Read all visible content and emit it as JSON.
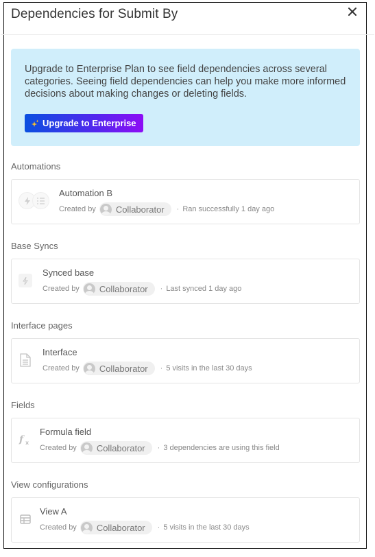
{
  "dialog": {
    "title": "Dependencies for Submit By",
    "close_icon": "close-icon"
  },
  "banner": {
    "text": "Upgrade to Enterprise Plan to see field dependencies across several categories. Seeing field dependencies can help you make more informed decisions about making changes or deleting fields.",
    "button_label": "Upgrade to Enterprise",
    "button_icon": "sparkle-icon",
    "background": "#d0eefb",
    "button_gradient": [
      "#0a4fe0",
      "#8d0df5"
    ]
  },
  "sections": [
    {
      "title": "Automations",
      "item": {
        "name": "Automation B",
        "created_by_label": "Created by",
        "collaborator": "Collaborator",
        "dot": "·",
        "status": "Ran successfully 1 day ago",
        "icons": [
          "lightning-icon",
          "checklist-icon"
        ]
      }
    },
    {
      "title": "Base Syncs",
      "item": {
        "name": "Synced base",
        "created_by_label": "Created by",
        "collaborator": "Collaborator",
        "dot": "·",
        "status": "Last synced 1 day ago",
        "icons": [
          "sync-bolt-icon"
        ]
      }
    },
    {
      "title": "Interface pages",
      "item": {
        "name": "Interface",
        "created_by_label": "Created by",
        "collaborator": "Collaborator",
        "dot": "·",
        "status": "5 visits in the last 30 days",
        "icons": [
          "document-icon"
        ]
      }
    },
    {
      "title": "Fields",
      "item": {
        "name": "Formula field",
        "created_by_label": "Created by",
        "collaborator": "Collaborator",
        "dot": "·",
        "status": "3 dependencies are using this field",
        "icons": [
          "formula-icon"
        ]
      }
    },
    {
      "title": "View configurations",
      "item": {
        "name": "View A",
        "created_by_label": "Created by",
        "collaborator": "Collaborator",
        "dot": "·",
        "status": "5 visits in the last 30 days",
        "icons": [
          "grid-view-icon"
        ]
      }
    }
  ]
}
